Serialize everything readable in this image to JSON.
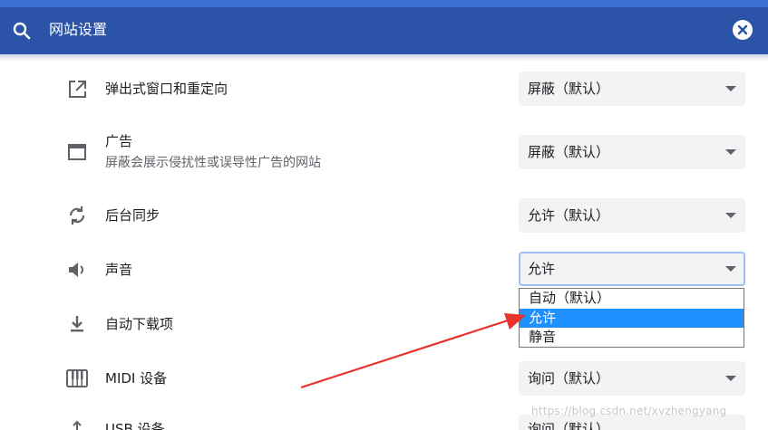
{
  "search": {
    "title": "网站设置"
  },
  "rows": {
    "popups": {
      "label": "弹出式窗口和重定向",
      "value": "屏蔽（默认）"
    },
    "ads": {
      "label": "广告",
      "sublabel": "屏蔽会展示侵扰性或误导性广告的网站",
      "value": "屏蔽（默认）"
    },
    "bgsync": {
      "label": "后台同步",
      "value": "允许（默认）"
    },
    "sound": {
      "label": "声音",
      "value": "允许"
    },
    "downloads": {
      "label": "自动下载项"
    },
    "midi": {
      "label": "MIDI 设备",
      "value": "询问（默认）"
    },
    "usb": {
      "label": "USB 设备",
      "value": "询问（默认）"
    }
  },
  "sound_dropdown": {
    "options": [
      "自动（默认）",
      "允许",
      "静音"
    ],
    "highlighted": "允许"
  },
  "annotation": {
    "color": "#e8322c"
  },
  "watermark": "https://blog.csdn.net/xvzhengyang",
  "colors": {
    "header": "#2b53a8",
    "highlight": "#1e90ff"
  }
}
